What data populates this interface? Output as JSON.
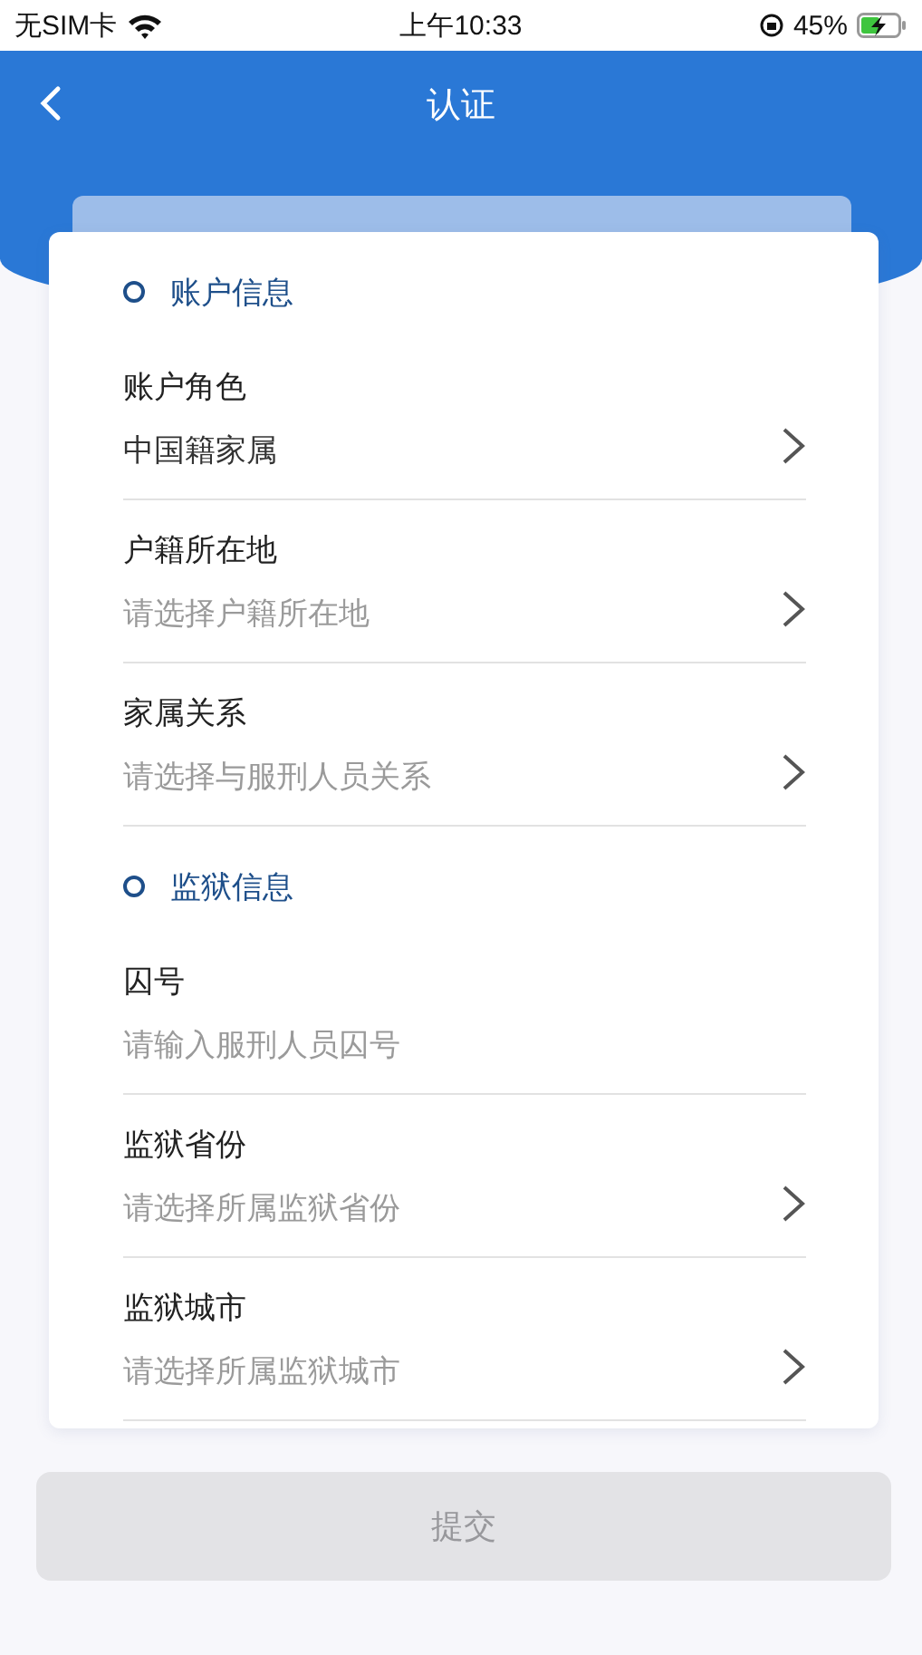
{
  "status_bar": {
    "carrier": "无SIM卡",
    "time": "上午10:33",
    "battery": "45%",
    "charging": true
  },
  "nav": {
    "title": "认证"
  },
  "sections": [
    {
      "title": "账户信息",
      "fields": [
        {
          "label": "账户角色",
          "kind": "select",
          "value": "中国籍家属"
        },
        {
          "label": "户籍所在地",
          "kind": "select",
          "placeholder": "请选择户籍所在地"
        },
        {
          "label": "家属关系",
          "kind": "select",
          "placeholder": "请选择与服刑人员关系"
        }
      ]
    },
    {
      "title": "监狱信息",
      "fields": [
        {
          "label": "囚号",
          "kind": "input",
          "placeholder": "请输入服刑人员囚号"
        },
        {
          "label": "监狱省份",
          "kind": "select",
          "placeholder": "请选择所属监狱省份"
        },
        {
          "label": "监狱城市",
          "kind": "select",
          "placeholder": "请选择所属监狱城市"
        }
      ]
    }
  ],
  "submit": {
    "label": "提交",
    "disabled": true
  }
}
